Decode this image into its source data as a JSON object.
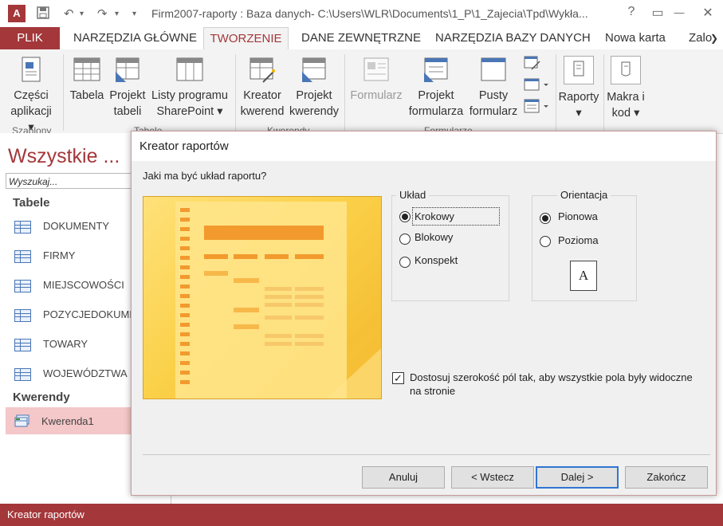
{
  "window": {
    "app_icon": "A",
    "title": "Firm2007-raporty : Baza danych- C:\\Users\\WLR\\Documents\\1_P\\1_Zajecia\\Tpd\\Wykła...",
    "help": "?",
    "restore_ribbon": "▭",
    "minimize": "—",
    "maximize": "☐",
    "close": "✕"
  },
  "qat": {
    "save": "💾",
    "undo": "↶",
    "redo": "↷",
    "customize": "▾"
  },
  "tabs": [
    "PLIK",
    "NARZĘDZIA GŁÓWNE",
    "TWORZENIE",
    "DANE ZEWNĘTRZNE",
    "NARZĘDZIA BAZY DANYCH",
    "Nowa karta",
    "Zalo"
  ],
  "ribbon": {
    "czesci_1": "Części",
    "czesci_2": "aplikacji ▾",
    "tabela": "Tabela",
    "projekt_tabeli_1": "Projekt",
    "projekt_tabeli_2": "tabeli",
    "listy_1": "Listy programu",
    "listy_2": "SharePoint ▾",
    "kreator_kwerend_1": "Kreator",
    "kreator_kwerend_2": "kwerend",
    "projekt_kwerendy_1": "Projekt",
    "projekt_kwerendy_2": "kwerendy",
    "formularz": "Formularz",
    "projekt_formularza_1": "Projekt",
    "projekt_formularza_2": "formularza",
    "pusty_1": "Pusty",
    "pusty_2": "formularz",
    "raporty": "Raporty",
    "raporty_arrow": "▾",
    "makra_1": "Makra i",
    "makra_2": "kod ▾",
    "group_szablony": "Szablony",
    "group_tabele": "Tabele",
    "group_kwerendy": "Kwerendy",
    "group_formularze": "Formularze"
  },
  "nav": {
    "title": "Wszystkie ...",
    "search_placeholder": "Wyszukaj...",
    "section_tables": "Tabele",
    "tables": [
      "DOKUMENTY",
      "FIRMY",
      "MIEJSCOWOŚCI",
      "POZYCJEDOKUMENTÓW",
      "TOWARY",
      "WOJEWÓDZTWA"
    ],
    "section_queries": "Kwerendy",
    "queries": [
      "Kwerenda1"
    ]
  },
  "dialog": {
    "title": "Kreator raportów",
    "question": "Jaki ma być układ raportu?",
    "layout_legend": "Układ",
    "layout_options": [
      "Krokowy",
      "Blokowy",
      "Konspekt"
    ],
    "orientation_legend": "Orientacja",
    "orientation_options": [
      "Pionowa",
      "Pozioma"
    ],
    "page_icon": "A",
    "checkbox_label": "Dostosuj szerokość pól tak, aby wszystkie pola były widoczne na stronie",
    "btn_cancel": "Anuluj",
    "btn_back": "< Wstecz",
    "btn_next": "Dalej >",
    "btn_finish": "Zakończ"
  },
  "status": {
    "text": "Kreator raportów"
  },
  "colors": {
    "accent": "#a4373a",
    "selection": "#f4c7c8",
    "preview": "#fbd14a",
    "default_button_border": "#2f76d2"
  }
}
